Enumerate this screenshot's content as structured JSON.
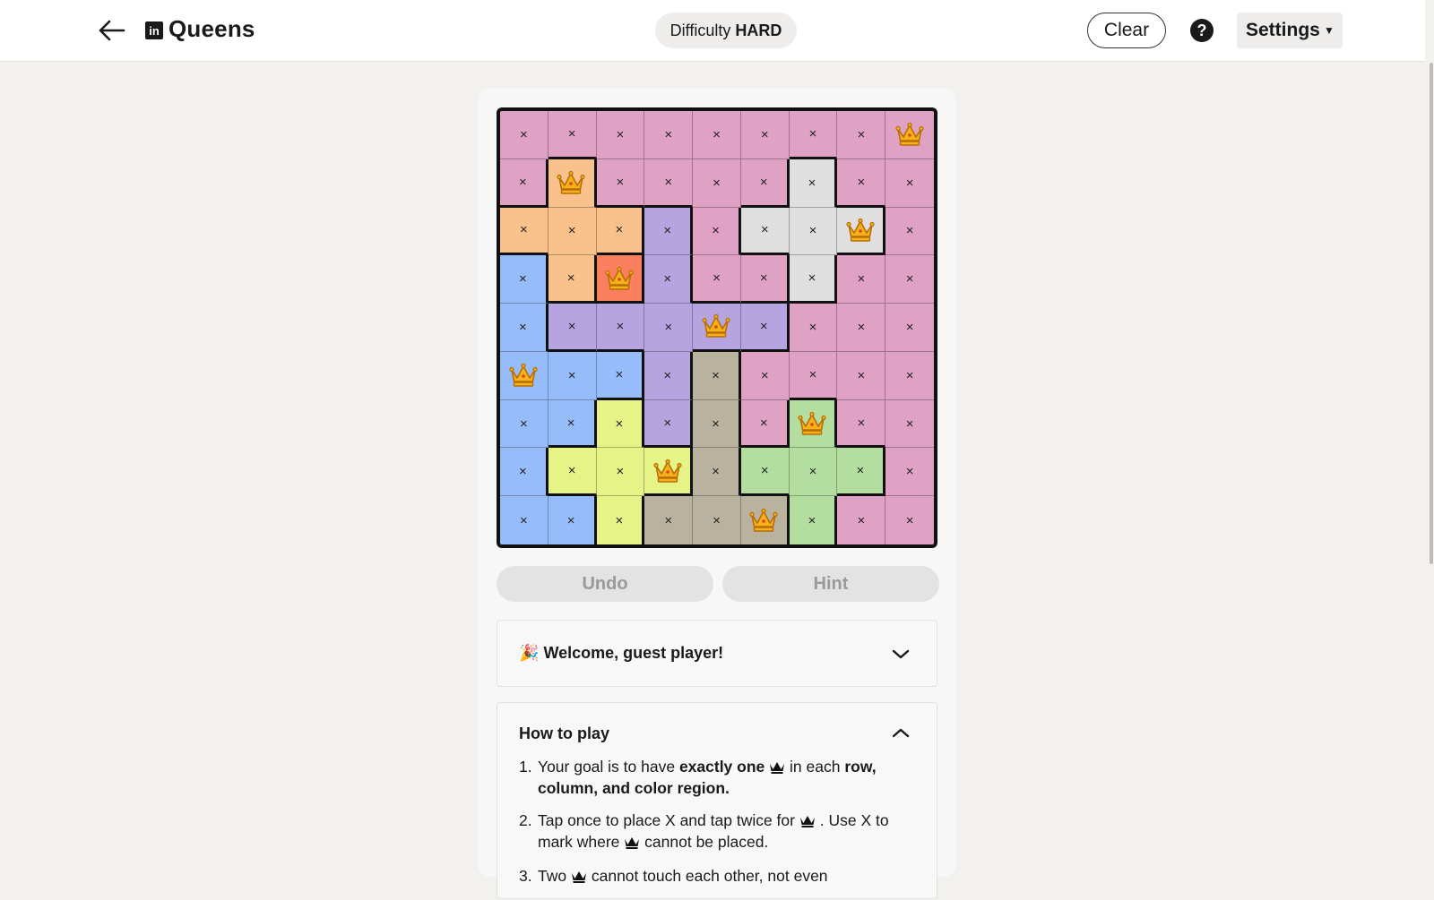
{
  "header": {
    "app_title": "Queens",
    "logo_letters": "in",
    "difficulty_label": "Difficulty",
    "difficulty_value": "HARD",
    "clear_label": "Clear",
    "help_label": "?",
    "settings_label": "Settings"
  },
  "board": {
    "size": 9,
    "colors": {
      "pink": "#dfa1c4",
      "orange": "#f9c18b",
      "lavender": "#b6a4e1",
      "gray": "#dfdfdf",
      "blue": "#96bdf9",
      "red": "#fa7f5d",
      "yellow": "#e6f387",
      "taupe": "#b9b29e",
      "green": "#b3dea0"
    },
    "regions": [
      [
        "pink",
        "pink",
        "pink",
        "pink",
        "pink",
        "pink",
        "pink",
        "pink",
        "pink"
      ],
      [
        "pink",
        "orange",
        "pink",
        "pink",
        "pink",
        "pink",
        "gray",
        "pink",
        "pink"
      ],
      [
        "orange",
        "orange",
        "orange",
        "lavender",
        "pink",
        "gray",
        "gray",
        "gray",
        "pink"
      ],
      [
        "blue",
        "orange",
        "red",
        "lavender",
        "pink",
        "pink",
        "gray",
        "pink",
        "pink"
      ],
      [
        "blue",
        "lavender",
        "lavender",
        "lavender",
        "lavender",
        "lavender",
        "pink",
        "pink",
        "pink"
      ],
      [
        "blue",
        "blue",
        "blue",
        "lavender",
        "taupe",
        "pink",
        "pink",
        "pink",
        "pink"
      ],
      [
        "blue",
        "blue",
        "yellow",
        "lavender",
        "taupe",
        "pink",
        "green",
        "pink",
        "pink"
      ],
      [
        "blue",
        "yellow",
        "yellow",
        "yellow",
        "taupe",
        "green",
        "green",
        "green",
        "pink"
      ],
      [
        "blue",
        "blue",
        "yellow",
        "taupe",
        "taupe",
        "taupe",
        "green",
        "pink",
        "pink"
      ]
    ],
    "queens": [
      [
        0,
        8
      ],
      [
        1,
        1
      ],
      [
        2,
        7
      ],
      [
        3,
        2
      ],
      [
        4,
        4
      ],
      [
        5,
        0
      ],
      [
        6,
        6
      ],
      [
        7,
        3
      ],
      [
        8,
        5
      ]
    ],
    "x_symbol": "×"
  },
  "controls": {
    "undo_label": "Undo",
    "hint_label": "Hint"
  },
  "welcome": {
    "emoji": "🎉",
    "title": "Welcome, guest player!"
  },
  "how_to_play": {
    "title": "How to play",
    "rules": [
      {
        "num": "1.",
        "a": "Your goal is to have ",
        "b": "exactly one",
        "c": " in each ",
        "d": "row, column, and color region."
      },
      {
        "num": "2.",
        "a": "Tap once to place X and tap twice for",
        "b": ". Use X to mark where",
        "c": "cannot be placed."
      },
      {
        "num": "3.",
        "a": "Two",
        "b": "cannot touch each other, not even"
      }
    ]
  }
}
